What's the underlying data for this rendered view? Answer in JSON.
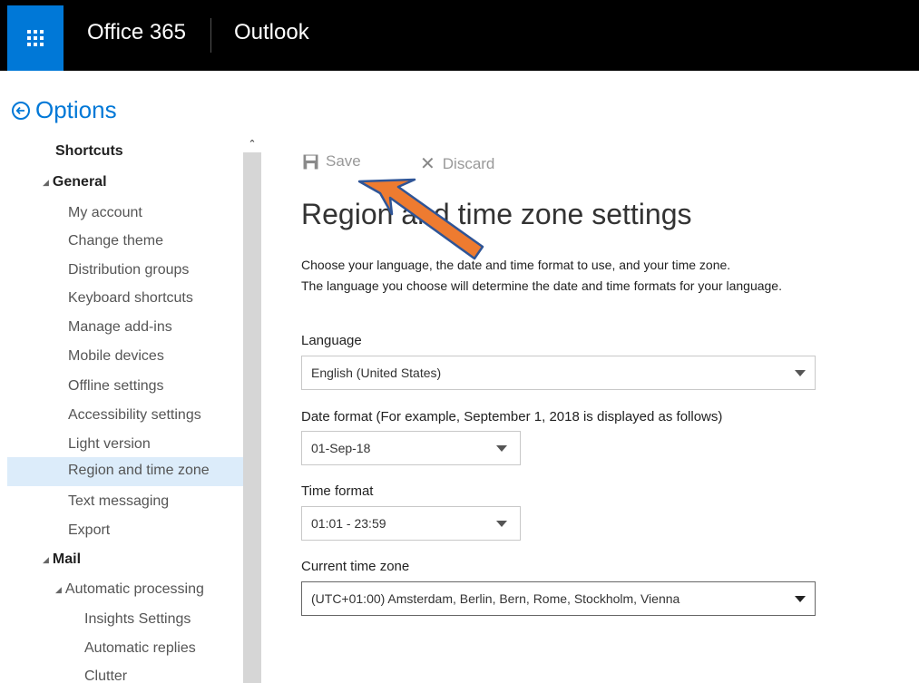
{
  "header": {
    "suite_name": "Office 365",
    "app_name": "Outlook"
  },
  "options": {
    "title": "Options"
  },
  "nav": {
    "items": [
      {
        "label": "Shortcuts"
      },
      {
        "label": "General"
      },
      {
        "label": "My account"
      },
      {
        "label": "Change theme"
      },
      {
        "label": "Distribution groups"
      },
      {
        "label": "Keyboard shortcuts"
      },
      {
        "label": "Manage add-ins"
      },
      {
        "label": "Mobile devices"
      },
      {
        "label": "Offline settings"
      },
      {
        "label": "Accessibility settings"
      },
      {
        "label": "Light version"
      },
      {
        "label": "Region and time zone"
      },
      {
        "label": "Text messaging"
      },
      {
        "label": "Export"
      },
      {
        "label": "Mail"
      },
      {
        "label": "Automatic processing"
      },
      {
        "label": "Insights Settings"
      },
      {
        "label": "Automatic replies"
      },
      {
        "label": "Clutter"
      }
    ]
  },
  "toolbar": {
    "save_label": "Save",
    "discard_label": "Discard"
  },
  "main": {
    "title": "Region and time zone settings",
    "description_line1": "Choose your language, the date and time format to use, and your time zone.",
    "description_line2": "The language you choose will determine the date and time formats for your language.",
    "language_label": "Language",
    "language_value": "English (United States)",
    "date_format_label": "Date format (For example, September 1, 2018 is displayed as follows)",
    "date_format_value": "01-Sep-18",
    "time_format_label": "Time format",
    "time_format_value": "01:01 - 23:59",
    "time_zone_label": "Current time zone",
    "time_zone_value": "(UTC+01:00) Amsterdam, Berlin, Bern, Rome, Stockholm, Vienna"
  },
  "colors": {
    "accent": "#0078d7",
    "selected_bg": "#dcecfa",
    "annotation_arrow": "#ee7b30",
    "annotation_outline": "#2f5597"
  }
}
